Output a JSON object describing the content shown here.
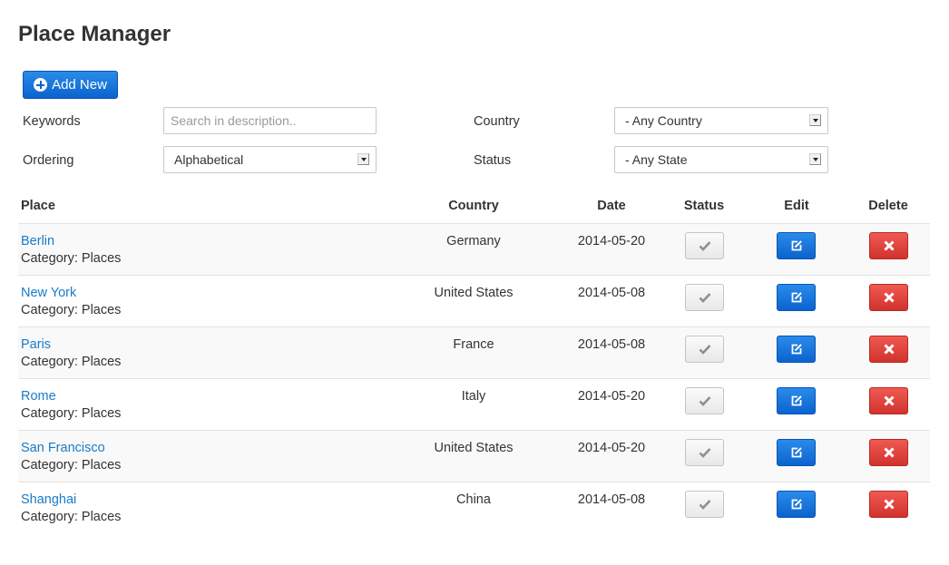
{
  "page": {
    "title": "Place Manager"
  },
  "toolbar": {
    "add_label": "Add New"
  },
  "filters": {
    "keywords_label": "Keywords",
    "keywords_placeholder": "Search in description..",
    "ordering_label": "Ordering",
    "ordering_value": "Alphabetical",
    "country_label": "Country",
    "country_value": "- Any Country",
    "status_label": "Status",
    "status_value": "- Any State"
  },
  "table": {
    "headers": {
      "place": "Place",
      "country": "Country",
      "date": "Date",
      "status": "Status",
      "edit": "Edit",
      "delete": "Delete"
    },
    "rows": [
      {
        "place": "Berlin",
        "category": "Category: Places",
        "country": "Germany",
        "date": "2014-05-20"
      },
      {
        "place": "New York",
        "category": "Category: Places",
        "country": "United States",
        "date": "2014-05-08"
      },
      {
        "place": "Paris",
        "category": "Category: Places",
        "country": "France",
        "date": "2014-05-08"
      },
      {
        "place": "Rome",
        "category": "Category: Places",
        "country": "Italy",
        "date": "2014-05-20"
      },
      {
        "place": "San Francisco",
        "category": "Category: Places",
        "country": "United States",
        "date": "2014-05-20"
      },
      {
        "place": "Shanghai",
        "category": "Category: Places",
        "country": "China",
        "date": "2014-05-08"
      }
    ]
  },
  "icons": {
    "add": "plus-circle-icon",
    "status": "check-icon",
    "edit": "edit-icon",
    "delete": "close-icon"
  },
  "colors": {
    "primary": "#0b63cf",
    "danger": "#d2322d",
    "link": "#1a7bc7"
  }
}
